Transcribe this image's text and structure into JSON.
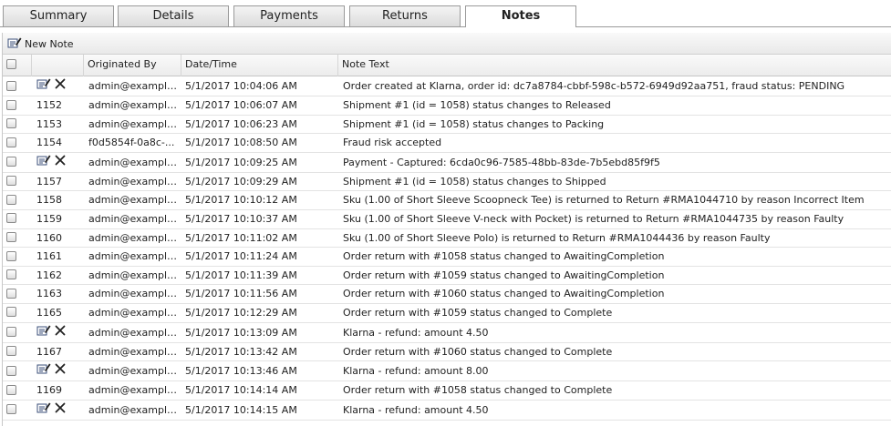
{
  "tabs": [
    {
      "label": "Summary",
      "active": false
    },
    {
      "label": "Details",
      "active": false
    },
    {
      "label": "Payments",
      "active": false
    },
    {
      "label": "Returns",
      "active": false
    },
    {
      "label": "Notes",
      "active": true
    }
  ],
  "toolbar": {
    "new_note_label": "New Note",
    "icon": "new-note-icon"
  },
  "columns": {
    "originated_by": "Originated By",
    "date_time": "Date/Time",
    "note_text": "Note Text"
  },
  "row_icons": {
    "edit": "edit-icon",
    "delete": "delete-icon"
  },
  "rows": [
    {
      "id": "",
      "editable": true,
      "originated_by": "admin@example...",
      "date_time": "5/1/2017 10:04:06 AM",
      "note_text": "Order created at Klarna, order id: dc7a8784-cbbf-598c-b572-6949d92aa751, fraud status: PENDING"
    },
    {
      "id": "1152",
      "editable": false,
      "originated_by": "admin@example...",
      "date_time": "5/1/2017 10:06:07 AM",
      "note_text": "Shipment #1 (id = 1058) status changes to Released"
    },
    {
      "id": "1153",
      "editable": false,
      "originated_by": "admin@example...",
      "date_time": "5/1/2017 10:06:23 AM",
      "note_text": "Shipment #1 (id = 1058) status changes to Packing"
    },
    {
      "id": "1154",
      "editable": false,
      "originated_by": "f0d5854f-0a8c-...",
      "date_time": "5/1/2017 10:08:50 AM",
      "note_text": "Fraud risk accepted"
    },
    {
      "id": "",
      "editable": true,
      "originated_by": "admin@example...",
      "date_time": "5/1/2017 10:09:25 AM",
      "note_text": "Payment - Captured: 6cda0c96-7585-48bb-83de-7b5ebd85f9f5"
    },
    {
      "id": "1157",
      "editable": false,
      "originated_by": "admin@example...",
      "date_time": "5/1/2017 10:09:29 AM",
      "note_text": "Shipment #1 (id = 1058) status changes to Shipped"
    },
    {
      "id": "1158",
      "editable": false,
      "originated_by": "admin@example...",
      "date_time": "5/1/2017 10:10:12 AM",
      "note_text": "Sku (1.00 of Short Sleeve Scoopneck Tee) is returned to Return #RMA1044710 by reason Incorrect Item"
    },
    {
      "id": "1159",
      "editable": false,
      "originated_by": "admin@example...",
      "date_time": "5/1/2017 10:10:37 AM",
      "note_text": "Sku (1.00 of Short Sleeve V-neck with Pocket) is returned to Return #RMA1044735 by reason Faulty"
    },
    {
      "id": "1160",
      "editable": false,
      "originated_by": "admin@example...",
      "date_time": "5/1/2017 10:11:02 AM",
      "note_text": "Sku (1.00 of Short Sleeve Polo) is returned to Return #RMA1044436 by reason Faulty"
    },
    {
      "id": "1161",
      "editable": false,
      "originated_by": "admin@example...",
      "date_time": "5/1/2017 10:11:24 AM",
      "note_text": "Order return with #1058 status changed to AwaitingCompletion"
    },
    {
      "id": "1162",
      "editable": false,
      "originated_by": "admin@example...",
      "date_time": "5/1/2017 10:11:39 AM",
      "note_text": "Order return with #1059 status changed to AwaitingCompletion"
    },
    {
      "id": "1163",
      "editable": false,
      "originated_by": "admin@example...",
      "date_time": "5/1/2017 10:11:56 AM",
      "note_text": "Order return with #1060 status changed to AwaitingCompletion"
    },
    {
      "id": "1165",
      "editable": false,
      "originated_by": "admin@example...",
      "date_time": "5/1/2017 10:12:29 AM",
      "note_text": "Order return with #1059 status changed to Complete"
    },
    {
      "id": "",
      "editable": true,
      "originated_by": "admin@example...",
      "date_time": "5/1/2017 10:13:09 AM",
      "note_text": "Klarna - refund: amount 4.50"
    },
    {
      "id": "1167",
      "editable": false,
      "originated_by": "admin@example...",
      "date_time": "5/1/2017 10:13:42 AM",
      "note_text": "Order return with #1060 status changed to Complete"
    },
    {
      "id": "",
      "editable": true,
      "originated_by": "admin@example...",
      "date_time": "5/1/2017 10:13:46 AM",
      "note_text": "Klarna - refund: amount 8.00"
    },
    {
      "id": "1169",
      "editable": false,
      "originated_by": "admin@example...",
      "date_time": "5/1/2017 10:14:14 AM",
      "note_text": "Order return with #1058 status changed to Complete"
    },
    {
      "id": "",
      "editable": true,
      "originated_by": "admin@example...",
      "date_time": "5/1/2017 10:14:15 AM",
      "note_text": "Klarna - refund: amount 4.50"
    }
  ]
}
